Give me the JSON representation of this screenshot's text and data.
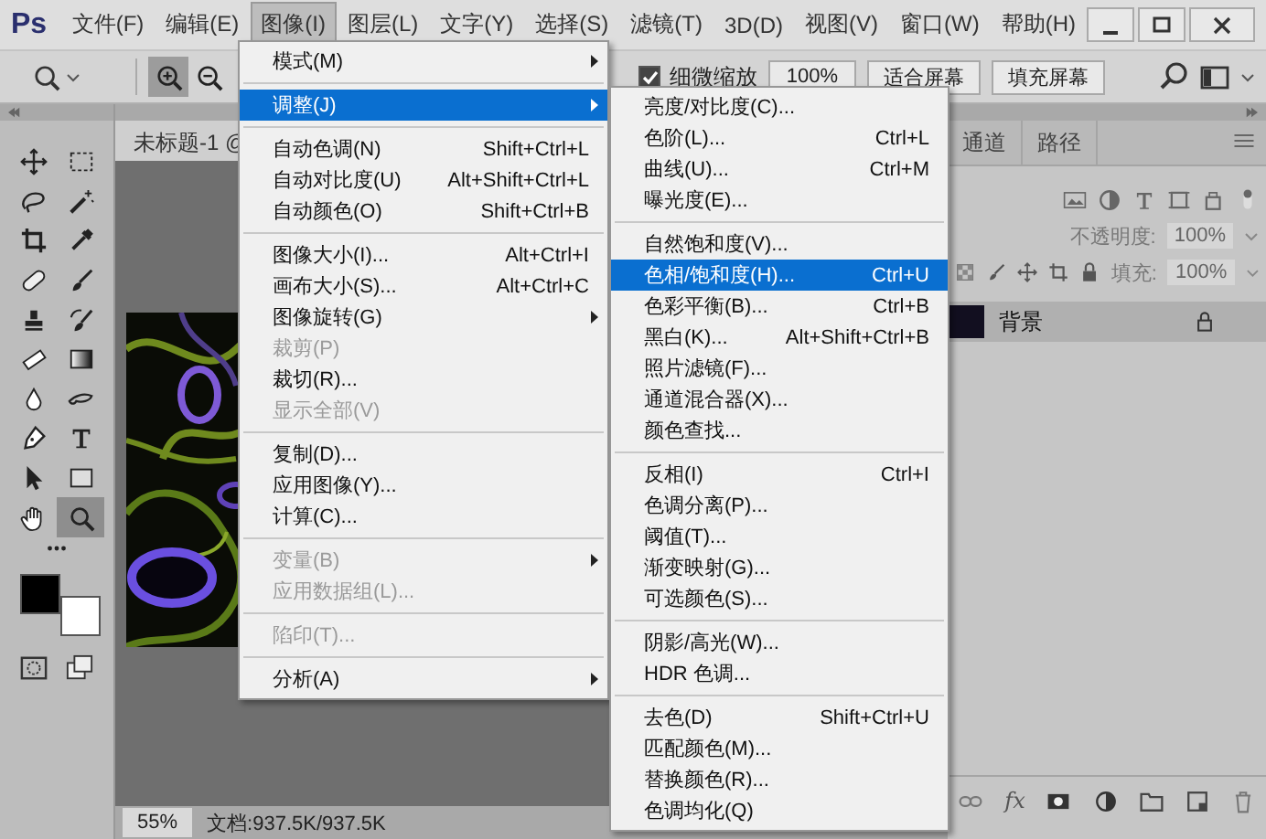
{
  "app_logo": "Ps",
  "menu_bar": [
    {
      "label": "文件(F)",
      "selected": false
    },
    {
      "label": "编辑(E)",
      "selected": false
    },
    {
      "label": "图像(I)",
      "selected": true
    },
    {
      "label": "图层(L)",
      "selected": false
    },
    {
      "label": "文字(Y)",
      "selected": false
    },
    {
      "label": "选择(S)",
      "selected": false
    },
    {
      "label": "滤镜(T)",
      "selected": false
    },
    {
      "label": "3D(D)",
      "selected": false
    },
    {
      "label": "视图(V)",
      "selected": false
    },
    {
      "label": "窗口(W)",
      "selected": false
    },
    {
      "label": "帮助(H)",
      "selected": false
    }
  ],
  "options_bar": {
    "zoom_modes": [
      {
        "kind": "zoom-in",
        "selected": true
      },
      {
        "kind": "zoom-out",
        "selected": false
      }
    ],
    "checkbox": {
      "label": "细微缩放",
      "checked": true
    },
    "buttons": [
      "100%",
      "适合屏幕",
      "填充屏幕"
    ]
  },
  "tools": [
    {
      "kind": "move",
      "selected": false
    },
    {
      "kind": "marquee",
      "selected": false
    },
    {
      "kind": "lasso",
      "selected": false
    },
    {
      "kind": "wand",
      "selected": false
    },
    {
      "kind": "crop",
      "selected": false
    },
    {
      "kind": "eyedropper",
      "selected": false
    },
    {
      "kind": "bandage",
      "selected": false
    },
    {
      "kind": "brush",
      "selected": false
    },
    {
      "kind": "stamp",
      "selected": false
    },
    {
      "kind": "history",
      "selected": false
    },
    {
      "kind": "eraser",
      "selected": false
    },
    {
      "kind": "gradient",
      "selected": false
    },
    {
      "kind": "droplet",
      "selected": false
    },
    {
      "kind": "finger",
      "selected": false
    },
    {
      "kind": "pen",
      "selected": false
    },
    {
      "kind": "type",
      "selected": false
    },
    {
      "kind": "arrow",
      "selected": false
    },
    {
      "kind": "rectangle",
      "selected": false
    },
    {
      "kind": "hand",
      "selected": false
    },
    {
      "kind": "zoom",
      "selected": true
    }
  ],
  "swatches": [
    {
      "color": "#000000"
    },
    {
      "color": "#ffffff"
    }
  ],
  "document": {
    "tab": "未标题-1 @",
    "zoom": "55%",
    "info": "文档:937.5K/937.5K"
  },
  "layers_panel": {
    "tabs": [
      {
        "label": "通道",
        "selected": false
      },
      {
        "label": "路径",
        "selected": false
      }
    ],
    "opacity_label": "不透明度:",
    "opacity": "100%",
    "fill_label": "填充:",
    "fill": "100%",
    "layers": [
      {
        "name": "背景",
        "locked": true
      }
    ],
    "fx": "fx"
  },
  "image_menu": {
    "groups": [
      [
        {
          "label": "模式(M)",
          "submenu": true,
          "disabled": false,
          "selected": false
        }
      ],
      [
        {
          "label": "调整(J)",
          "submenu": true,
          "disabled": false,
          "selected": true
        }
      ],
      [
        {
          "label": "自动色调(N)",
          "shortcut": "Shift+Ctrl+L",
          "submenu": false,
          "disabled": false,
          "selected": false
        },
        {
          "label": "自动对比度(U)",
          "shortcut": "Alt+Shift+Ctrl+L",
          "submenu": false,
          "disabled": false,
          "selected": false
        },
        {
          "label": "自动颜色(O)",
          "shortcut": "Shift+Ctrl+B",
          "submenu": false,
          "disabled": false,
          "selected": false
        }
      ],
      [
        {
          "label": "图像大小(I)...",
          "shortcut": "Alt+Ctrl+I",
          "submenu": false,
          "disabled": false,
          "selected": false
        },
        {
          "label": "画布大小(S)...",
          "shortcut": "Alt+Ctrl+C",
          "submenu": false,
          "disabled": false,
          "selected": false
        },
        {
          "label": "图像旋转(G)",
          "submenu": true,
          "disabled": false,
          "selected": false
        },
        {
          "label": "裁剪(P)",
          "submenu": false,
          "disabled": true,
          "selected": false
        },
        {
          "label": "裁切(R)...",
          "submenu": false,
          "disabled": false,
          "selected": false
        },
        {
          "label": "显示全部(V)",
          "submenu": false,
          "disabled": true,
          "selected": false
        }
      ],
      [
        {
          "label": "复制(D)...",
          "submenu": false,
          "disabled": false,
          "selected": false
        },
        {
          "label": "应用图像(Y)...",
          "submenu": false,
          "disabled": false,
          "selected": false
        },
        {
          "label": "计算(C)...",
          "submenu": false,
          "disabled": false,
          "selected": false
        }
      ],
      [
        {
          "label": "变量(B)",
          "submenu": true,
          "disabled": true,
          "selected": false
        },
        {
          "label": "应用数据组(L)...",
          "submenu": false,
          "disabled": true,
          "selected": false
        }
      ],
      [
        {
          "label": "陷印(T)...",
          "submenu": false,
          "disabled": true,
          "selected": false
        }
      ],
      [
        {
          "label": "分析(A)",
          "submenu": true,
          "disabled": false,
          "selected": false
        }
      ]
    ]
  },
  "adjust_submenu": {
    "groups": [
      [
        {
          "label": "亮度/对比度(C)...",
          "submenu": false,
          "disabled": false,
          "selected": false
        },
        {
          "label": "色阶(L)...",
          "shortcut": "Ctrl+L",
          "submenu": false,
          "disabled": false,
          "selected": false
        },
        {
          "label": "曲线(U)...",
          "shortcut": "Ctrl+M",
          "submenu": false,
          "disabled": false,
          "selected": false
        },
        {
          "label": "曝光度(E)...",
          "submenu": false,
          "disabled": false,
          "selected": false
        }
      ],
      [
        {
          "label": "自然饱和度(V)...",
          "submenu": false,
          "disabled": false,
          "selected": false
        },
        {
          "label": "色相/饱和度(H)...",
          "shortcut": "Ctrl+U",
          "submenu": false,
          "disabled": false,
          "selected": true
        },
        {
          "label": "色彩平衡(B)...",
          "shortcut": "Ctrl+B",
          "submenu": false,
          "disabled": false,
          "selected": false
        },
        {
          "label": "黑白(K)...",
          "shortcut": "Alt+Shift+Ctrl+B",
          "submenu": false,
          "disabled": false,
          "selected": false
        },
        {
          "label": "照片滤镜(F)...",
          "submenu": false,
          "disabled": false,
          "selected": false
        },
        {
          "label": "通道混合器(X)...",
          "submenu": false,
          "disabled": false,
          "selected": false
        },
        {
          "label": "颜色查找...",
          "submenu": false,
          "disabled": false,
          "selected": false
        }
      ],
      [
        {
          "label": "反相(I)",
          "shortcut": "Ctrl+I",
          "submenu": false,
          "disabled": false,
          "selected": false
        },
        {
          "label": "色调分离(P)...",
          "submenu": false,
          "disabled": false,
          "selected": false
        },
        {
          "label": "阈值(T)...",
          "submenu": false,
          "disabled": false,
          "selected": false
        },
        {
          "label": "渐变映射(G)...",
          "submenu": false,
          "disabled": false,
          "selected": false
        },
        {
          "label": "可选颜色(S)...",
          "submenu": false,
          "disabled": false,
          "selected": false
        }
      ],
      [
        {
          "label": "阴影/高光(W)...",
          "submenu": false,
          "disabled": false,
          "selected": false
        },
        {
          "label": "HDR 色调...",
          "submenu": false,
          "disabled": false,
          "selected": false
        }
      ],
      [
        {
          "label": "去色(D)",
          "shortcut": "Shift+Ctrl+U",
          "submenu": false,
          "disabled": false,
          "selected": false
        },
        {
          "label": "匹配颜色(M)...",
          "submenu": false,
          "disabled": false,
          "selected": false
        },
        {
          "label": "替换颜色(R)...",
          "submenu": false,
          "disabled": false,
          "selected": false
        },
        {
          "label": "色调均化(Q)",
          "submenu": false,
          "disabled": false,
          "selected": false
        }
      ]
    ]
  }
}
